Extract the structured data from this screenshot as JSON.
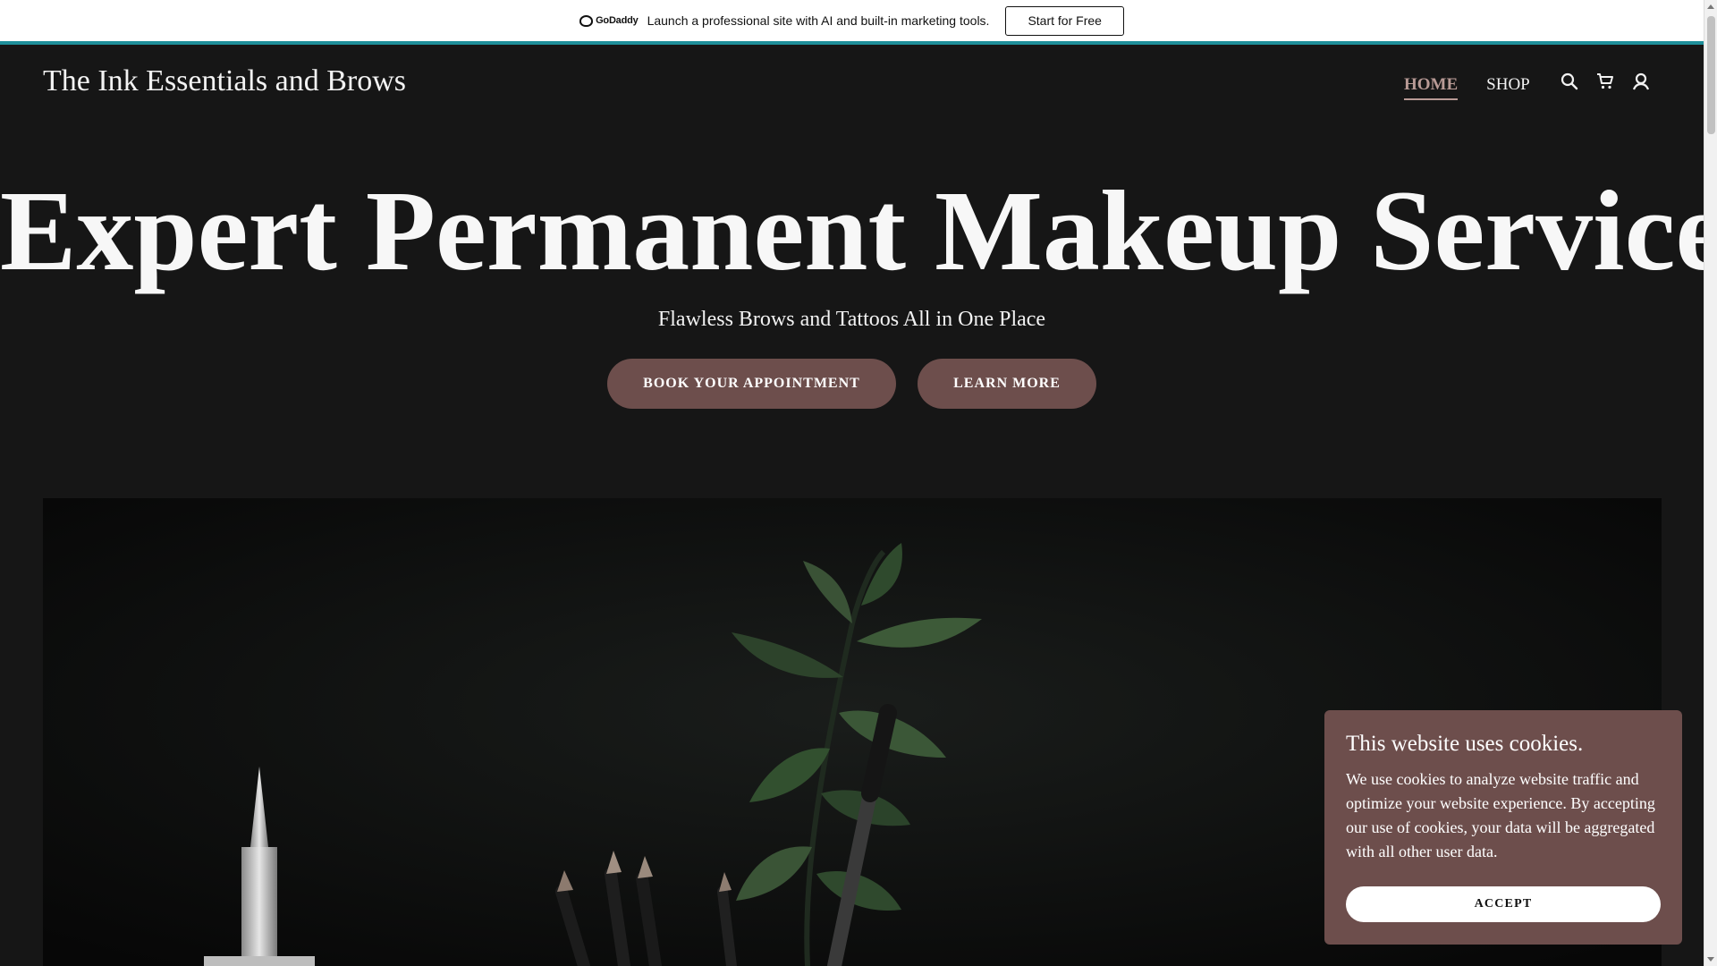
{
  "promo": {
    "logo_text": "GoDaddy",
    "message": "Launch a professional site with AI and built-in marketing tools.",
    "cta_label": "Start for Free",
    "accent_color": "#1e8f9a"
  },
  "header": {
    "site_title": "The Ink Essentials and Brows",
    "nav": [
      {
        "label": "HOME",
        "active": true
      },
      {
        "label": "SHOP",
        "active": false
      }
    ],
    "icons": [
      "search-icon",
      "cart-icon",
      "account-icon"
    ]
  },
  "hero": {
    "title": "Expert Permanent Makeup Services",
    "subtitle": "Flawless Brows and Tattoos All in One Place",
    "buttons": [
      {
        "label": "BOOK YOUR APPOINTMENT"
      },
      {
        "label": "LEARN MORE"
      }
    ]
  },
  "cookie_banner": {
    "title": "This website uses cookies.",
    "body": "We use cookies to analyze website traffic and optimize your website experience. By accepting our use of cookies, your data will be aggregated with all other user data.",
    "accept_label": "ACCEPT"
  },
  "colors": {
    "background": "#161616",
    "button": "#6d4e4c",
    "nav_active": "#b89a95"
  }
}
